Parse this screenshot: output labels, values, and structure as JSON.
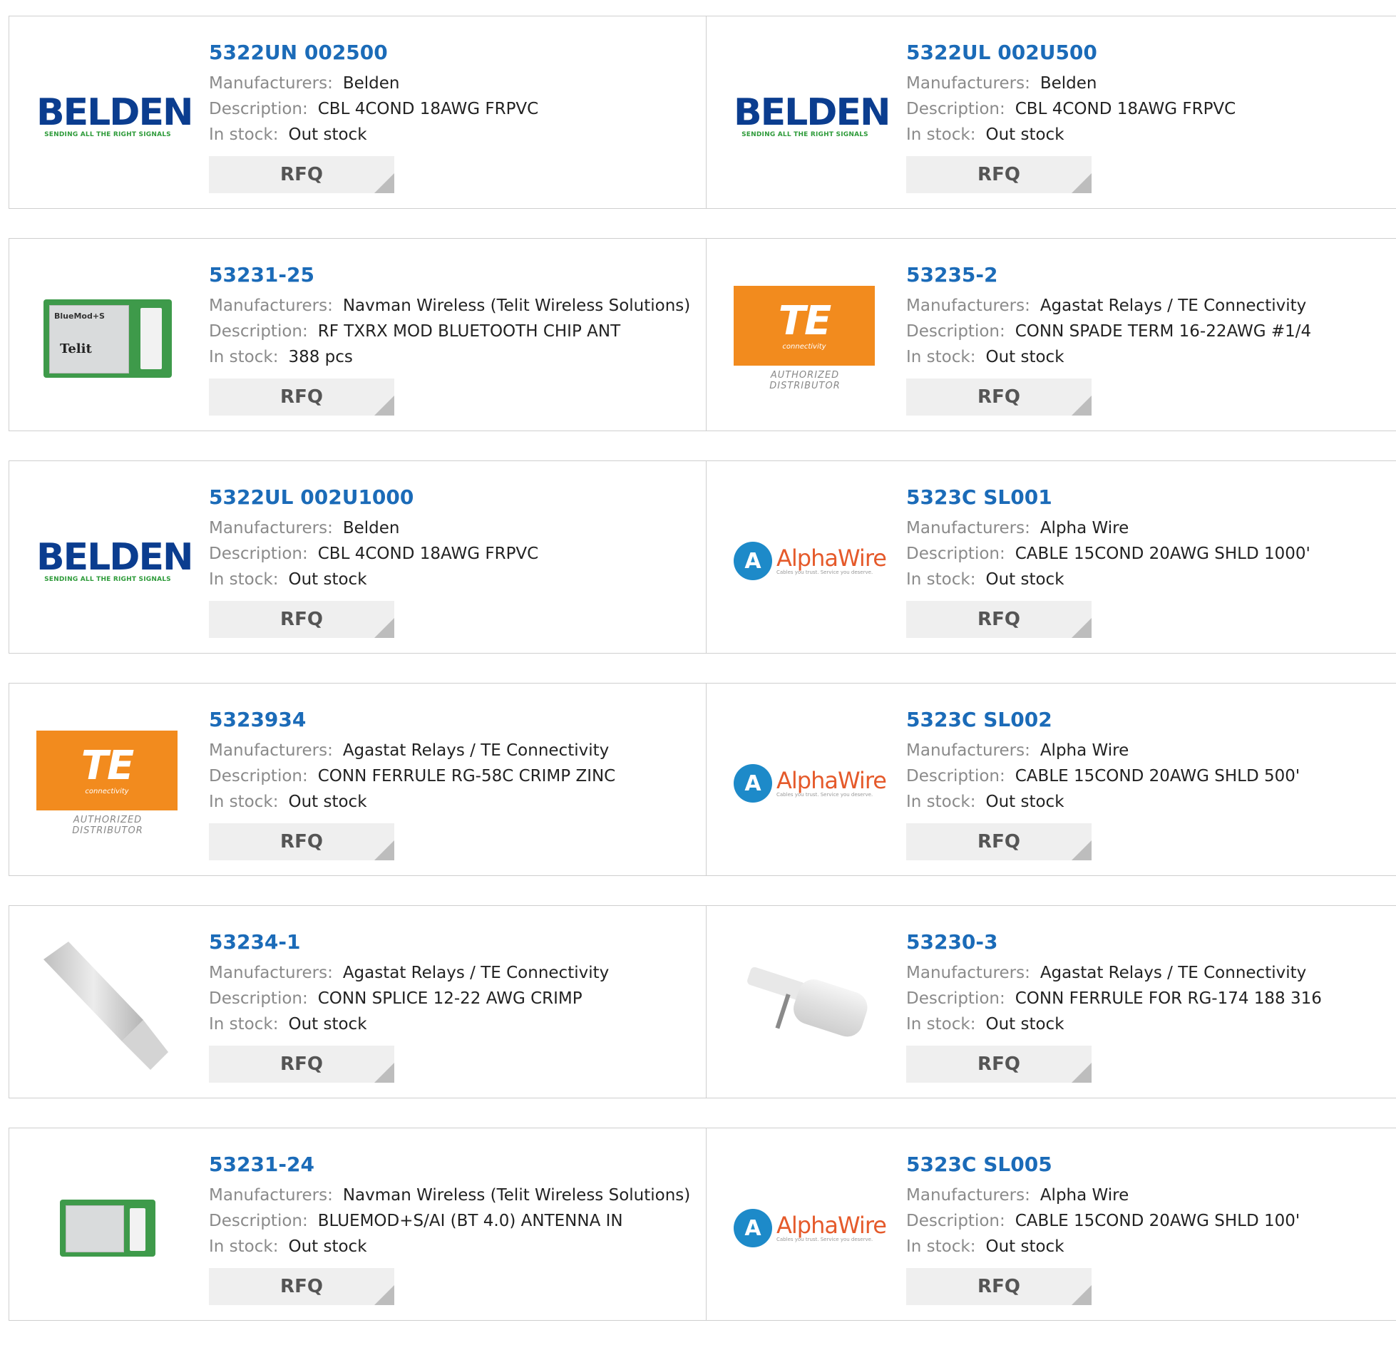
{
  "labels": {
    "manufacturers": "Manufacturers:",
    "description": "Description:",
    "stock": "In stock:",
    "rfq": "RFQ"
  },
  "logos": {
    "belden_word": "BELDEN",
    "belden_tag": "SENDING ALL THE RIGHT SIGNALS",
    "te_mark": "TE",
    "te_sub": "connectivity",
    "te_auth": "AUTHORIZED DISTRIBUTOR",
    "alpha_name": "AlphaWire",
    "alpha_tag": "Cables you trust. Service you deserve.",
    "telit": "Telit",
    "bluemod": "BlueMod+S"
  },
  "products": [
    {
      "part": "5322UN 002500",
      "manufacturer": "Belden",
      "description": "CBL 4COND 18AWG FRPVC",
      "stock": "Out stock",
      "logo": "belden"
    },
    {
      "part": "5322UL 002U500",
      "manufacturer": "Belden",
      "description": "CBL 4COND 18AWG FRPVC",
      "stock": "Out stock",
      "logo": "belden"
    },
    {
      "part": "53231-25",
      "manufacturer": "Navman Wireless (Telit Wireless Solutions)",
      "description": "RF TXRX MOD BLUETOOTH CHIP ANT",
      "stock": "388 pcs",
      "logo": "bluetooth-module"
    },
    {
      "part": "53235-2",
      "manufacturer": "Agastat Relays / TE Connectivity",
      "description": "CONN SPADE TERM 16-22AWG #1/4",
      "stock": "Out stock",
      "logo": "te"
    },
    {
      "part": "5322UL 002U1000",
      "manufacturer": "Belden",
      "description": "CBL 4COND 18AWG FRPVC",
      "stock": "Out stock",
      "logo": "belden"
    },
    {
      "part": "5323C SL001",
      "manufacturer": "Alpha Wire",
      "description": "CABLE 15COND 20AWG SHLD 1000'",
      "stock": "Out stock",
      "logo": "alphawire"
    },
    {
      "part": "5323934",
      "manufacturer": "Agastat Relays / TE Connectivity",
      "description": "CONN FERRULE RG-58C CRIMP ZINC",
      "stock": "Out stock",
      "logo": "te"
    },
    {
      "part": "5323C SL002",
      "manufacturer": "Alpha Wire",
      "description": "CABLE 15COND 20AWG SHLD 500'",
      "stock": "Out stock",
      "logo": "alphawire"
    },
    {
      "part": "53234-1",
      "manufacturer": "Agastat Relays / TE Connectivity",
      "description": "CONN SPLICE 12-22 AWG CRIMP",
      "stock": "Out stock",
      "logo": "splice"
    },
    {
      "part": "53230-3",
      "manufacturer": "Agastat Relays / TE Connectivity",
      "description": "CONN FERRULE FOR RG-174 188 316",
      "stock": "Out stock",
      "logo": "ferrule"
    },
    {
      "part": "53231-24",
      "manufacturer": "Navman Wireless (Telit Wireless Solutions)",
      "description": "BLUEMOD+S/AI (BT 4.0) ANTENNA IN",
      "stock": "Out stock",
      "logo": "bluetooth-module-small"
    },
    {
      "part": "5323C SL005",
      "manufacturer": "Alpha Wire",
      "description": "CABLE 15COND 20AWG SHLD 100'",
      "stock": "Out stock",
      "logo": "alphawire"
    }
  ]
}
